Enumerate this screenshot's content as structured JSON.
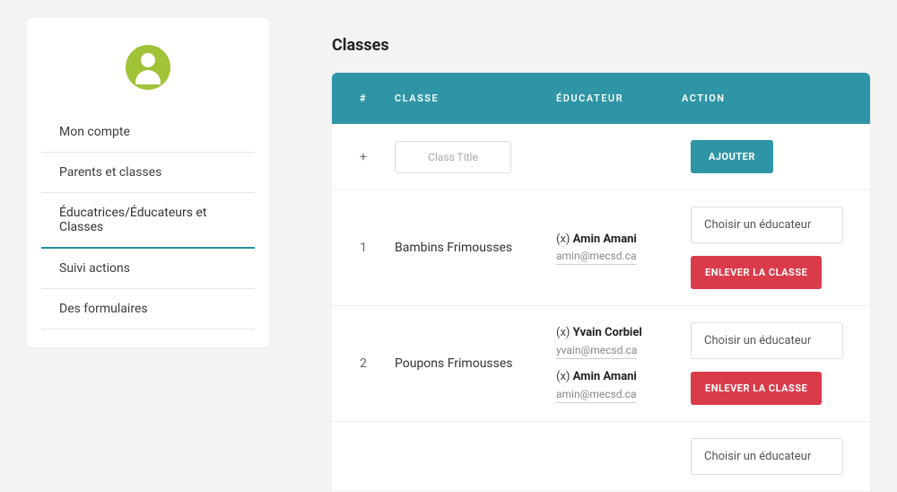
{
  "sidebar": {
    "items": [
      {
        "label": "Mon compte",
        "active": false
      },
      {
        "label": "Parents et classes",
        "active": false
      },
      {
        "label": "Éducatrices/Éducateurs et Classes",
        "active": true
      },
      {
        "label": "Suivi actions",
        "active": false
      },
      {
        "label": "Des formulaires",
        "active": false
      }
    ]
  },
  "main": {
    "title": "Classes",
    "headers": {
      "index": "#",
      "classe": "Classe",
      "educateur": "Éducateur",
      "action": "Action"
    },
    "addRow": {
      "symbol": "+",
      "placeholder": "Class Title",
      "button": "AJOUTER"
    },
    "selectPlaceholder": "Choisir un éducateur",
    "removeLabel": "ENLEVER LA CLASSE",
    "rows": [
      {
        "idx": "1",
        "className": "Bambins Frimousses",
        "educators": [
          {
            "x": "(x)",
            "name": "Amin Amani",
            "email": "amin@mecsd.ca"
          }
        ]
      },
      {
        "idx": "2",
        "className": "Poupons Frimousses",
        "educators": [
          {
            "x": "(x)",
            "name": "Yvain Corbiel",
            "email": "yvain@mecsd.ca"
          },
          {
            "x": "(x)",
            "name": "Amin Amani",
            "email": "amin@mecsd.ca"
          }
        ]
      }
    ]
  }
}
